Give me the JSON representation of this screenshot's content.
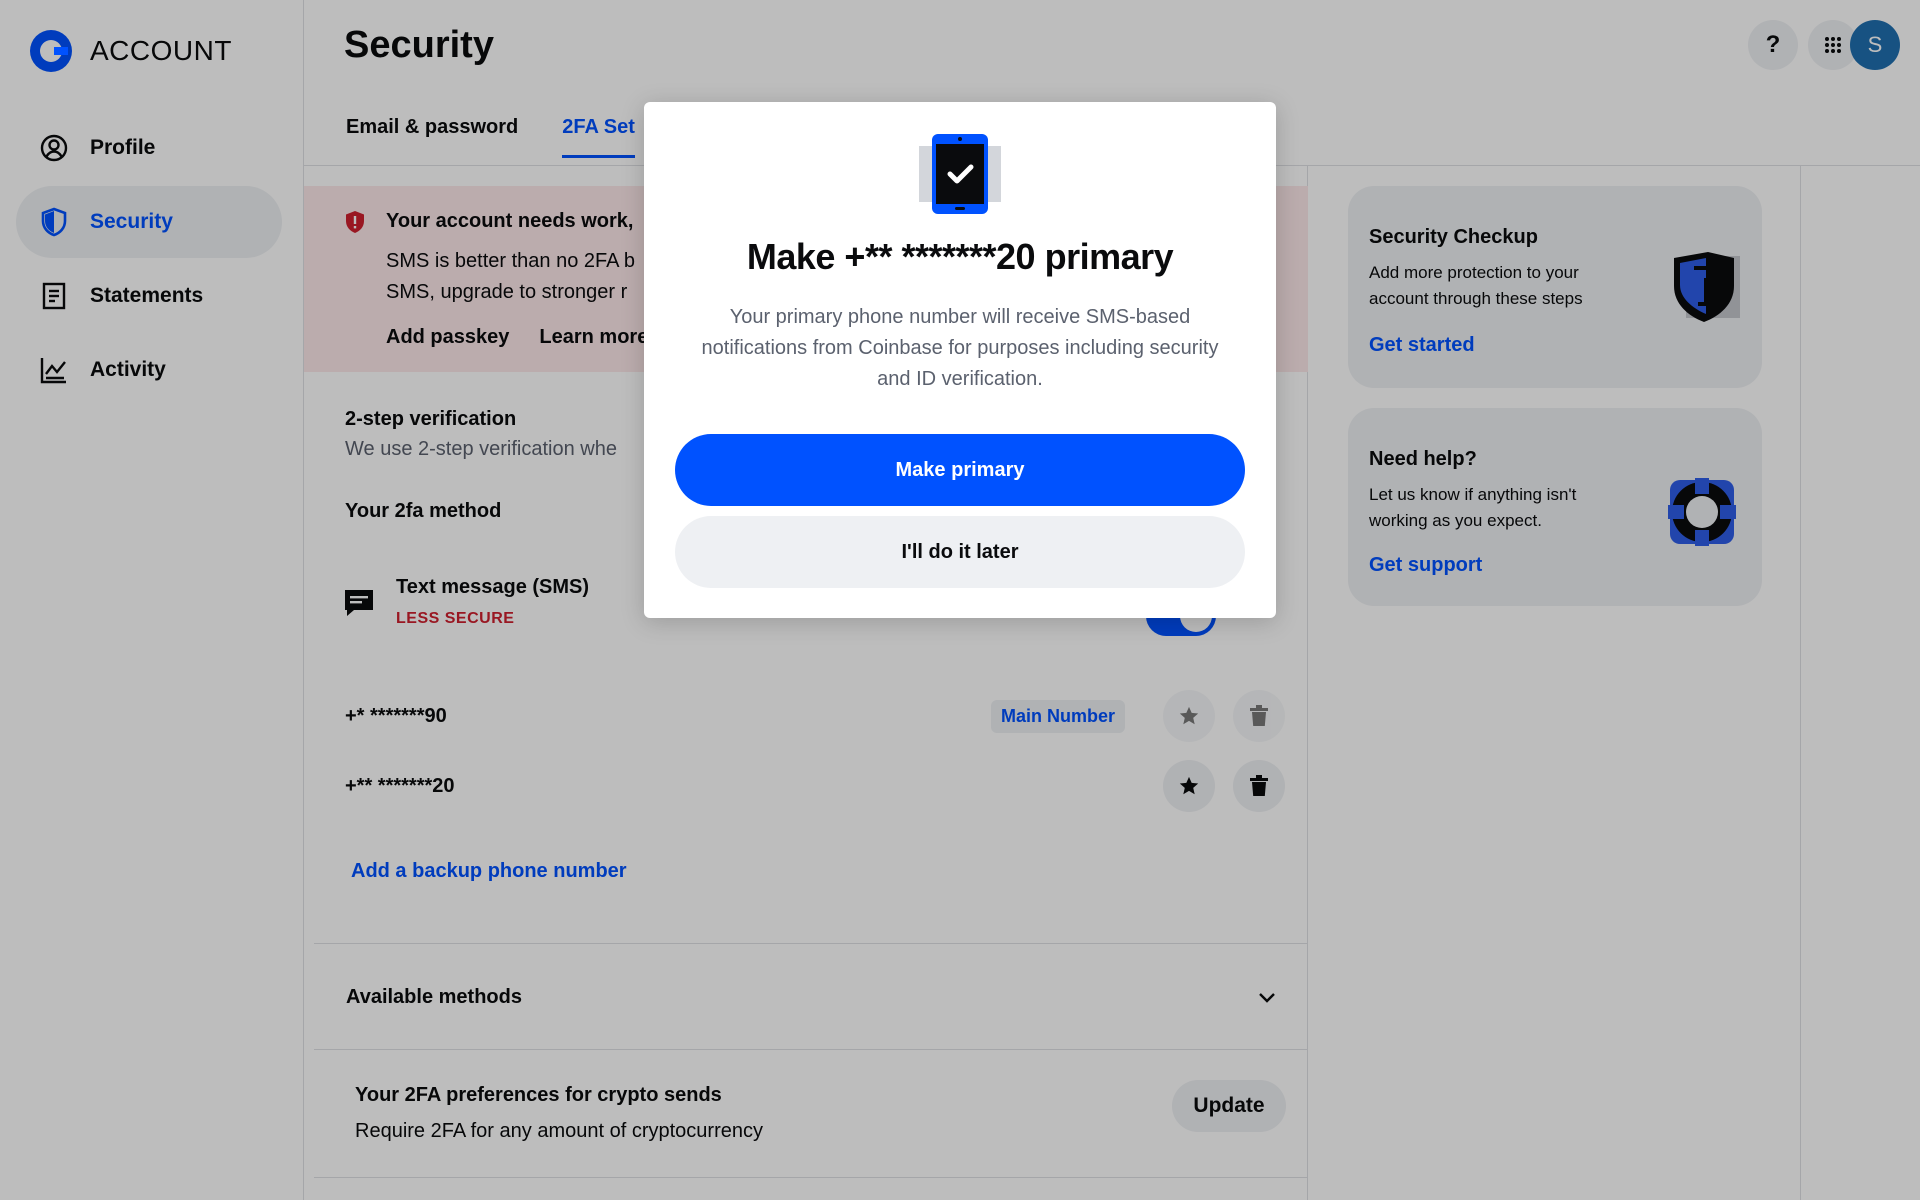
{
  "brand": {
    "name": "ACCOUNT"
  },
  "sidebar": {
    "items": [
      {
        "label": "Profile",
        "icon": "user-circle-icon",
        "active": false
      },
      {
        "label": "Security",
        "icon": "shield-icon",
        "active": true
      },
      {
        "label": "Statements",
        "icon": "document-icon",
        "active": false
      },
      {
        "label": "Activity",
        "icon": "activity-chart-icon",
        "active": false
      }
    ]
  },
  "header": {
    "title": "Security",
    "tabs": [
      {
        "label": "Email & password",
        "active": false
      },
      {
        "label": "2FA Set",
        "active": true
      }
    ],
    "help_label": "?",
    "avatar_initial": "S"
  },
  "alert": {
    "title": "Your account needs work,",
    "body_line1": "SMS is better than no 2FA b",
    "body_line2": "SMS, upgrade to stronger r",
    "actions": [
      "Add passkey",
      "Learn more"
    ]
  },
  "two_step": {
    "title": "2-step verification",
    "description": "We use 2-step verification whe",
    "method_title": "Your 2fa method",
    "sms_title": "Text message (SMS)",
    "sms_badge": "LESS SECURE"
  },
  "phones": [
    {
      "number": "+* *******90",
      "badge": "Main Number"
    },
    {
      "number": "+** *******20",
      "badge": ""
    }
  ],
  "add_backup_label": "Add a backup phone number",
  "available_methods_label": "Available methods",
  "preferences": {
    "title": "Your 2FA preferences for crypto sends",
    "description": "Require 2FA for any amount of cryptocurrency",
    "button": "Update"
  },
  "cards": {
    "checkup": {
      "title": "Security Checkup",
      "description": "Add more protection to your account through these steps",
      "link": "Get started"
    },
    "help": {
      "title": "Need help?",
      "description": "Let us know if anything isn't working as you expect.",
      "link": "Get support"
    }
  },
  "modal": {
    "title": "Make +** *******20 primary",
    "body": "Your primary phone number will receive SMS-based notifications from Coinbase for purposes including security and ID verification.",
    "primary_button": "Make primary",
    "secondary_button": "I'll do it later"
  },
  "colors": {
    "accent": "#0052ff",
    "danger": "#cf202f",
    "alert_bg": "#fde8ea",
    "surface": "#eef0f3"
  }
}
